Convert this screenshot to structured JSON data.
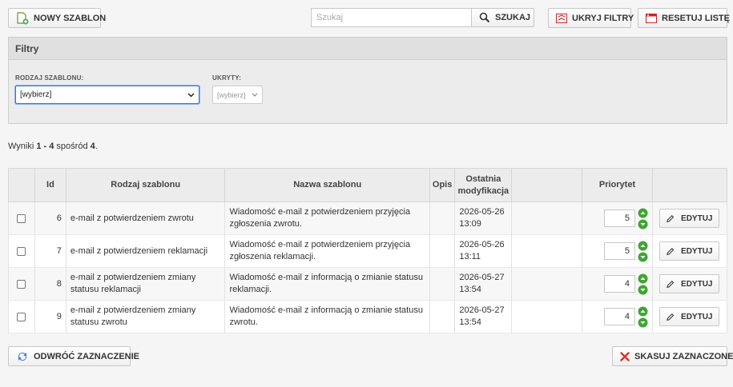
{
  "toolbar": {
    "new_template": "NOWY SZABLON",
    "search_placeholder": "Szukaj",
    "search_button": "SZUKAJ",
    "hide_filters": "UKRYJ FILTRY",
    "reset_list": "RESETUJ LISTĘ"
  },
  "filters": {
    "title": "Filtry",
    "type_label": "RODZAJ SZABLONU:",
    "type_value": "[wybierz]",
    "hidden_label": "UKRYTY:",
    "hidden_value": "[wybierz]"
  },
  "results": {
    "prefix": "Wyniki ",
    "range": "1 - 4",
    "middle": " spośród ",
    "total": "4",
    "suffix": "."
  },
  "table": {
    "headers": {
      "id": "Id",
      "type": "Rodzaj szablonu",
      "name": "Nazwa szablonu",
      "desc": "Opis",
      "modified_line1": "Ostatnia",
      "modified_line2": "modyfikacja",
      "priority": "Priorytet"
    },
    "edit_label": "EDYTUJ",
    "rows": [
      {
        "id": "6",
        "type": "e-mail z potwierdzeniem zwrotu",
        "name": "Wiadomość e-mail z potwierdzeniem przyjęcia zgłoszenia zwrotu.",
        "desc": "",
        "date": "2026-05-26",
        "time": "13:09",
        "priority": "5"
      },
      {
        "id": "7",
        "type": "e-mail z potwierdzeniem reklamacji",
        "name": "Wiadomość e-mail z potwierdzeniem przyjęcia zgłoszenia reklamacji.",
        "desc": "",
        "date": "2026-05-26",
        "time": "13:11",
        "priority": "5"
      },
      {
        "id": "8",
        "type": "e-mail z potwierdzeniem zmiany statusu reklamacji",
        "name": "Wiadomość e-mail z informacją o zmianie statusu reklamacji.",
        "desc": "",
        "date": "2026-05-27",
        "time": "13:54",
        "priority": "4"
      },
      {
        "id": "9",
        "type": "e-mail z potwierdzeniem zmiany statusu zwrotu",
        "name": "Wiadomość e-mail z informacją o zmianie statusu zwrotu.",
        "desc": "",
        "date": "2026-05-27",
        "time": "13:54",
        "priority": "4"
      }
    ]
  },
  "footer": {
    "invert_selection": "ODWRÓĆ ZAZNACZENIE",
    "delete_selected": "SKASUJ ZAZNACZONE"
  },
  "colors": {
    "arrow_green": "#3fa534",
    "delete_red": "#d9342b",
    "filter_icon_red": "#c62828",
    "focus_blue": "#2b78e4"
  }
}
